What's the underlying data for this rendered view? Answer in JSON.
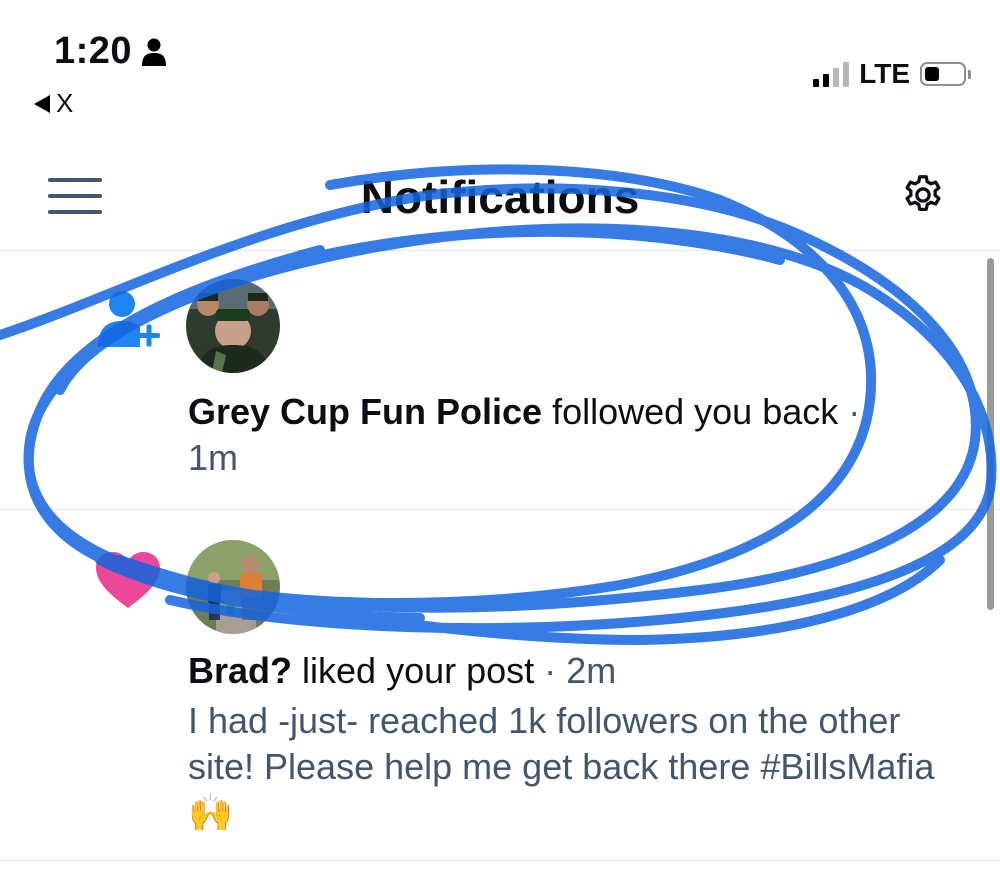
{
  "status_bar": {
    "time": "1:20",
    "back_label": "X",
    "network": "LTE",
    "battery_level": 0.4
  },
  "header": {
    "title": "Notifications",
    "menu_icon": "hamburger-icon",
    "settings_icon": "gear-icon"
  },
  "notifications": [
    {
      "type_icon": "follow-icon",
      "name": "Grey Cup Fun Police",
      "action": "followed you back",
      "separator": "·",
      "time": "1m"
    },
    {
      "type_icon": "heart-icon",
      "name": "Brad?",
      "action": "liked your post",
      "separator": "·",
      "time": "2m",
      "post_text": "I had -just- reached 1k followers on the other site! Please help me get back there #BillsMafia",
      "post_emoji": "🙌"
    }
  ],
  "colors": {
    "accent": "#1d84f2",
    "heart": "#ec4899",
    "muted_text": "#42576c",
    "scribble": "#1565e0"
  }
}
